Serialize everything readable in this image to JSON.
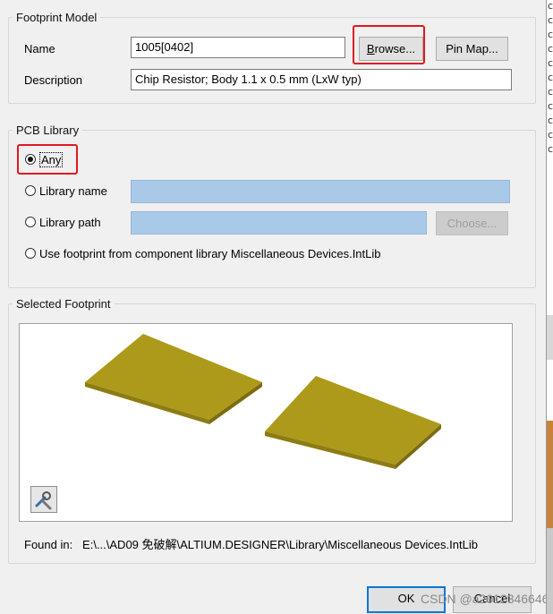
{
  "footprint_model": {
    "legend": "Footprint Model",
    "name_label": "Name",
    "name_value": "1005[0402]",
    "browse_label": "Browse...",
    "pinmap_label": "Pin Map...",
    "description_label": "Description",
    "description_value": "Chip Resistor; Body 1.1 x 0.5 mm (LxW typ)"
  },
  "pcb_library": {
    "legend": "PCB Library",
    "options": {
      "any": "Any",
      "library_name": "Library name",
      "library_path": "Library path",
      "component_library": "Use footprint from component library Miscellaneous Devices.IntLib"
    },
    "selected": "any",
    "choose_label": "Choose..."
  },
  "selected_footprint": {
    "legend": "Selected Footprint",
    "found_in_label": "Found in:",
    "found_in_path": "E:\\...\\AD09 免破解\\ALTIUM.DESIGNER\\Library\\Miscellaneous Devices.IntLib",
    "pad_color": "#ad9a1b"
  },
  "footer": {
    "ok_label": "OK",
    "cancel_label": "Cancel",
    "watermark": "CSDN @a2012346646"
  },
  "background_window": {
    "edge_chars": [
      "c",
      "c",
      "c",
      "c",
      "c",
      "c",
      "c",
      "c",
      "c",
      "c",
      "c"
    ]
  }
}
